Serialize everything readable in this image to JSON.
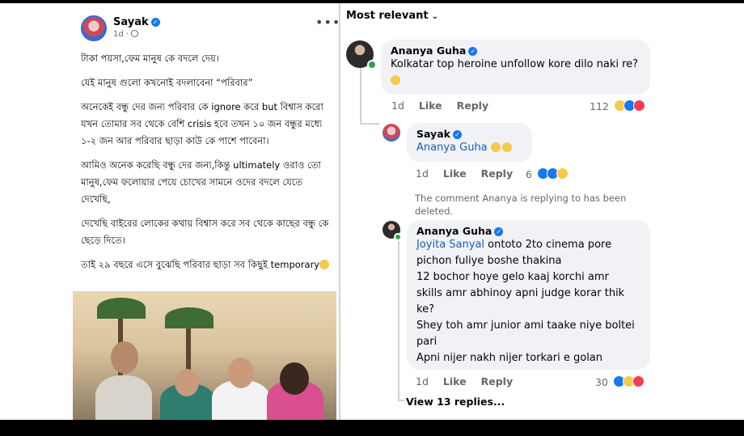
{
  "post": {
    "author": "Sayak",
    "time": "1d",
    "paragraphs": [
      "টাকা পয়সা,ফেম মানুষ কে বদলে দেয়।",
      "যেই মানুষ গুলো কখনোই বদলাবেনা “পরিবার”",
      "অনেকেই বন্ধু দের জন্য পরিবার কে ignore করে but বিশ্বাস করো যখন তোমার সব থেকে বেশি crisis হবে তখন ১০ জন বন্ধুর মধ্যে ১-২ জন আর পরিবার ছাড়া কাউ কে পাশে পাবেনা।",
      "আমিও অনেক করেছি বন্ধু দের জন্য,কিন্তু ultimately ওরাও তো মানুষ,ফেম ফলোয়ার পেয়ে চোখের সামনে ওদের বদলে যেতে দেখেছি,",
      "দেখেছি বাইরের লোকের কথায় বিশ্বাস করে সব থেকে কাছের বন্ধু কে ছেড়ে দিতে।",
      "তাই ২৯ বছরে এসে বুঝেছি পরিবার ছাড়া সব কিছুই temporary"
    ]
  },
  "comments_header": {
    "sort_label": "Most relevant"
  },
  "comments": [
    {
      "author": "Ananya Guha",
      "text": "Kolkatar top heroine unfollow kore dilo naki re?",
      "time": "1d",
      "like": "Like",
      "reply": "Reply",
      "reaction_count": "112"
    },
    {
      "author": "Sayak",
      "mention": "Ananya Guha",
      "time": "1d",
      "like": "Like",
      "reply": "Reply",
      "reaction_count": "6"
    },
    {
      "deleted_note": "The comment Ananya is replying to has been deleted."
    },
    {
      "author": "Ananya Guha",
      "mention": "Joyita Sanyal",
      "lines": [
        "ontoto 2to cinema pore",
        "pichon fuliye boshe thakina",
        "12 bochor hoye gelo kaaj korchi amr",
        "skills amr abhinoy apni judge korar thik",
        "ke?",
        "Shey toh amr junior ami taake niye boltei",
        "pari",
        "Apni nijer nakh nijer torkari e golan"
      ],
      "time": "1d",
      "like": "Like",
      "reply": "Reply",
      "reaction_count": "30"
    }
  ],
  "view_replies": "View 13 replies..."
}
